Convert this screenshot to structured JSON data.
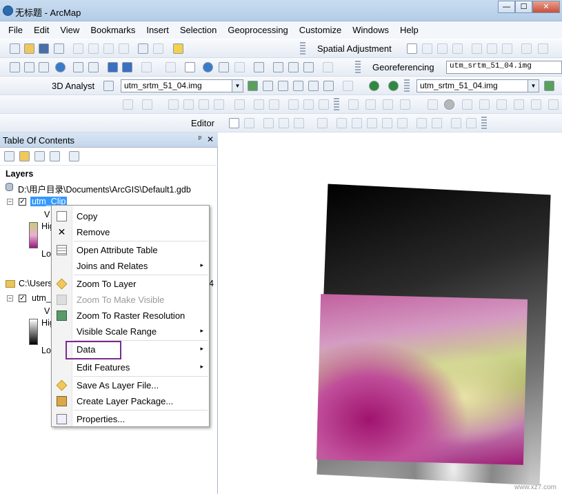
{
  "window": {
    "title": "无标题 - ArcMap",
    "controls": [
      "—",
      "☐",
      "✕"
    ]
  },
  "menubar": [
    "File",
    "Edit",
    "View",
    "Bookmarks",
    "Insert",
    "Selection",
    "Geoprocessing",
    "Customize",
    "Windows",
    "Help"
  ],
  "toolbars": {
    "spatial_adjustment": "Spatial Adjustment",
    "georeferencing": "Georeferencing",
    "georef_layer": "utm_srtm_51_04.img",
    "analyst_3d": "3D Analyst",
    "analyst_layer": "utm_srtm_51_04.img",
    "second_layer": "utm_srtm_51_04.img",
    "editor": "Editor"
  },
  "toc": {
    "title": "Table Of Contents",
    "pin": "ᵖ",
    "close": "✕",
    "layers_label": "Layers",
    "gdb_path": "D:\\用户目录\\Documents\\ArcGIS\\Default1.gdb",
    "layer1": {
      "name": "utm_Clip",
      "v_label": "V",
      "high": "Hig",
      "low": "Lo"
    },
    "folder2": "C:\\Users",
    "folder2_suffix": "4",
    "layer2": {
      "name": "utm_",
      "v_label": "V",
      "high": "Hig",
      "low": "Lo"
    }
  },
  "context_menu": {
    "items": [
      {
        "label": "Copy",
        "icon": "copy-icon"
      },
      {
        "label": "Remove",
        "icon": "remove-icon"
      },
      {
        "label": "Open Attribute Table",
        "icon": "table-icon"
      },
      {
        "label": "Joins and Relates",
        "submenu": true
      },
      {
        "label": "Zoom To Layer",
        "icon": "zoom-layer-icon"
      },
      {
        "label": "Zoom To Make Visible",
        "disabled": true
      },
      {
        "label": "Zoom To Raster Resolution",
        "icon": "zoom-raster-icon"
      },
      {
        "label": "Visible Scale Range",
        "submenu": true
      },
      {
        "label": "Data",
        "submenu": true,
        "highlighted": true
      },
      {
        "label": "Edit Features",
        "submenu": true
      },
      {
        "label": "Save As Layer File...",
        "icon": "layer-file-icon"
      },
      {
        "label": "Create Layer Package...",
        "icon": "package-icon"
      },
      {
        "label": "Properties...",
        "icon": "properties-icon"
      }
    ],
    "submenu_arrow": "▸"
  },
  "watermark": "www.xz7.com",
  "colors": {
    "highlight_box": "#7a2a8e",
    "selection": "#3399ff",
    "titlebar": "#c9dcf0"
  }
}
